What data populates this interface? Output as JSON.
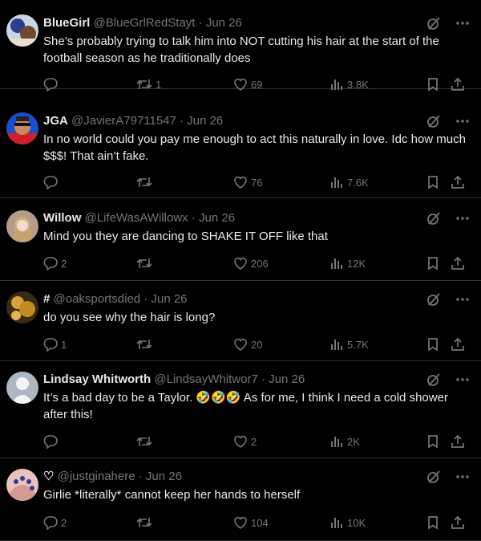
{
  "colors": {
    "background": "#000000",
    "text": "#e7e9ea",
    "secondary": "#71767b",
    "border": "#2f3336"
  },
  "tweets": [
    {
      "name": "BlueGirl",
      "handle": "@BlueGrlRedStayt",
      "time": "Jun 26",
      "text": "She’s probably trying to talk him into NOT cutting his hair at the start of the football season as he traditionally does",
      "replies": "",
      "reposts": "1",
      "likes": "69",
      "views": "3.8K"
    },
    {
      "name": "JGA",
      "handle": "@JavierA79711547",
      "time": "Jun 26",
      "text": "In no world could you pay me enough to act this naturally in love. Idc how much $$$! That ain’t fake.",
      "replies": "",
      "reposts": "",
      "likes": "76",
      "views": "7.6K"
    },
    {
      "name": "Willow",
      "handle": "@LifeWasAWillowx",
      "time": "Jun 26",
      "text": "Mind you they are dancing to SHAKE IT OFF like that",
      "replies": "2",
      "reposts": "",
      "likes": "206",
      "views": "12K"
    },
    {
      "name": "#",
      "handle": "@oaksportsdied",
      "time": "Jun 26",
      "text": "do you see why the hair is long?",
      "replies": "1",
      "reposts": "",
      "likes": "20",
      "views": "5.7K"
    },
    {
      "name": "Lindsay Whitworth",
      "handle": "@LindsayWhitwor7",
      "time": "Jun 26",
      "text_before": "It’s a bad day to be a Taylor. ",
      "emoji": "🤣🤣🤣",
      "text_after": " As for me, I think I need a cold shower after this!",
      "replies": "",
      "reposts": "",
      "likes": "2",
      "views": "2K"
    },
    {
      "name": "♡",
      "handle": "@justginahere",
      "time": "Jun 26",
      "text": "Girlie *literally* cannot keep her hands to herself",
      "replies": "2",
      "reposts": "",
      "likes": "104",
      "views": "10K"
    }
  ],
  "separator": "·",
  "icons": [
    "grok-icon",
    "more-icon",
    "reply-icon",
    "repost-icon",
    "like-icon",
    "views-icon",
    "bookmark-icon",
    "share-icon"
  ]
}
